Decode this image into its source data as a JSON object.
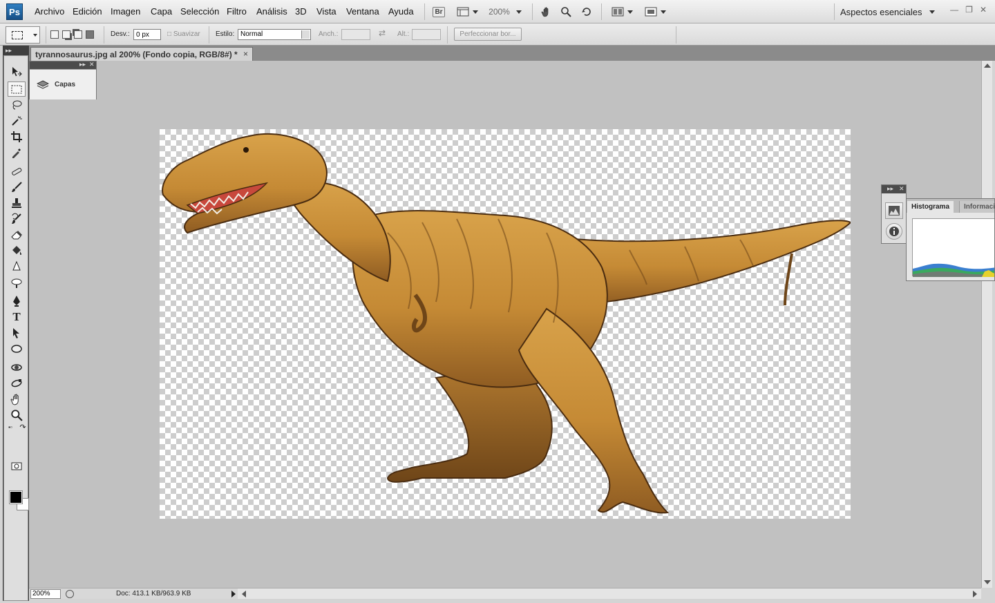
{
  "app": {
    "logo": "Ps",
    "menu": [
      "Archivo",
      "Edición",
      "Imagen",
      "Capa",
      "Selección",
      "Filtro",
      "Análisis",
      "3D",
      "Vista",
      "Ventana",
      "Ayuda"
    ],
    "bridge_label": "Br",
    "zoom_label": "200%",
    "workspace": "Aspectos esenciales"
  },
  "options": {
    "feather_label": "Desv.:",
    "feather_value": "0 px",
    "antialias_label": "Suavizar",
    "style_label": "Estilo:",
    "style_value": "Normal",
    "width_label": "Anch.:",
    "height_label": "Alt.:",
    "refine_label": "Perfeccionar bor..."
  },
  "document": {
    "tab_title": "tyrannosaurus.jpg al 200% (Fondo copia, RGB/8#) *",
    "close_glyph": "×"
  },
  "panels": {
    "layers_label": "Capas",
    "histogram_tab": "Histograma",
    "info_tab": "Informaci"
  },
  "status": {
    "zoom": "200%",
    "doc_info": "Doc: 413.1 KB/963.9 KB"
  },
  "colors": {
    "foreground": "#000000",
    "background": "#ffffff"
  },
  "icons": [
    "move-icon",
    "rect-marquee-icon",
    "lasso-icon",
    "magic-wand-icon",
    "crop-icon",
    "eyedropper-icon",
    "healing-brush-icon",
    "brush-icon",
    "clone-stamp-icon",
    "history-brush-icon",
    "eraser-icon",
    "paint-bucket-icon",
    "blur-icon",
    "dodge-icon",
    "pen-icon",
    "type-icon",
    "path-selection-icon",
    "ellipse-shape-icon",
    "3d-rotate-icon",
    "3d-orbit-icon",
    "hand-icon",
    "zoom-icon"
  ]
}
